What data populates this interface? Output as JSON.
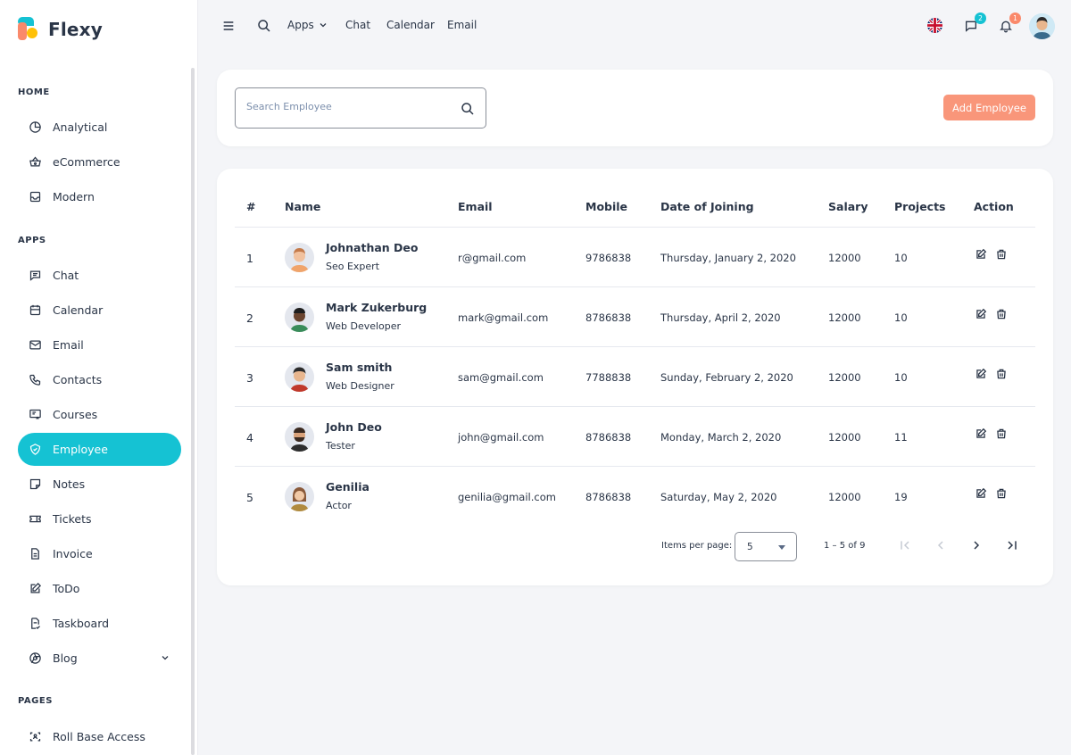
{
  "brand": {
    "name": "Flexy"
  },
  "sidebar": {
    "sections": {
      "home": "HOME",
      "apps": "APPS",
      "pages": "PAGES"
    },
    "items": [
      {
        "label": "Analytical",
        "icon": "pie-chart-icon"
      },
      {
        "label": "eCommerce",
        "icon": "basket-icon"
      },
      {
        "label": "Modern",
        "icon": "inbox-icon"
      },
      {
        "label": "Chat",
        "icon": "message-icon"
      },
      {
        "label": "Calendar",
        "icon": "calendar-icon"
      },
      {
        "label": "Email",
        "icon": "mail-icon"
      },
      {
        "label": "Contacts",
        "icon": "phone-icon"
      },
      {
        "label": "Courses",
        "icon": "chalkboard-icon"
      },
      {
        "label": "Employee",
        "icon": "shield-icon",
        "active": true
      },
      {
        "label": "Notes",
        "icon": "note-icon"
      },
      {
        "label": "Tickets",
        "icon": "ticket-icon"
      },
      {
        "label": "Invoice",
        "icon": "file-text-icon"
      },
      {
        "label": "ToDo",
        "icon": "edit-icon"
      },
      {
        "label": "Taskboard",
        "icon": "file-check-icon"
      },
      {
        "label": "Blog",
        "icon": "chrome-icon"
      },
      {
        "label": "Roll Base Access",
        "icon": "scan-icon"
      }
    ]
  },
  "topbar": {
    "links": {
      "apps": "Apps",
      "chat": "Chat",
      "calendar": "Calendar",
      "email": "Email"
    },
    "messages_count": "2",
    "notifications_count": "1"
  },
  "search": {
    "placeholder": "Search Employee",
    "value": ""
  },
  "add_button": "Add Employee",
  "table": {
    "headers": {
      "num": "#",
      "name": "Name",
      "email": "Email",
      "mobile": "Mobile",
      "doj": "Date of Joining",
      "salary": "Salary",
      "projects": "Projects",
      "action": "Action"
    },
    "rows": [
      {
        "num": "1",
        "name": "Johnathan Deo",
        "role": "Seo Expert",
        "email": "r@gmail.com",
        "mobile": "9786838",
        "doj": "Thursday, January 2, 2020",
        "salary": "12000",
        "projects": "10"
      },
      {
        "num": "2",
        "name": "Mark Zukerburg",
        "role": "Web Developer",
        "email": "mark@gmail.com",
        "mobile": "8786838",
        "doj": "Thursday, April 2, 2020",
        "salary": "12000",
        "projects": "10"
      },
      {
        "num": "3",
        "name": "Sam smith",
        "role": "Web Designer",
        "email": "sam@gmail.com",
        "mobile": "7788838",
        "doj": "Sunday, February 2, 2020",
        "salary": "12000",
        "projects": "10"
      },
      {
        "num": "4",
        "name": "John Deo",
        "role": "Tester",
        "email": "john@gmail.com",
        "mobile": "8786838",
        "doj": "Monday, March 2, 2020",
        "salary": "12000",
        "projects": "11"
      },
      {
        "num": "5",
        "name": "Genilia",
        "role": "Actor",
        "email": "genilia@gmail.com",
        "mobile": "8786838",
        "doj": "Saturday, May 2, 2020",
        "salary": "12000",
        "projects": "19"
      }
    ]
  },
  "pagination": {
    "items_per_page_label": "Items per page:",
    "items_per_page": "5",
    "range": "1 – 5 of 9"
  },
  "colors": {
    "accent": "#15c2d3",
    "secondary": "#fa896b",
    "text": "#2a3547"
  }
}
